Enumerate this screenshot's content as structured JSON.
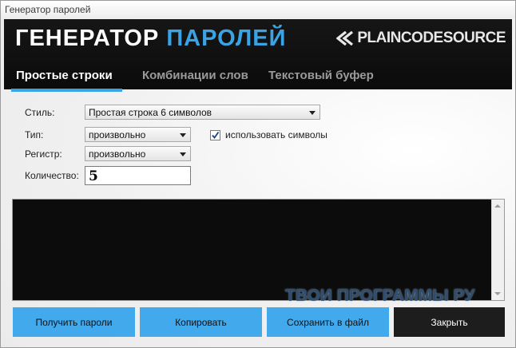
{
  "window": {
    "title": "Генератор паролей"
  },
  "banner": {
    "logo_part1": "ГЕНЕРАТОР",
    "logo_part2": "ПАРОЛЕЙ",
    "brand": "PLAINCODESOURCE"
  },
  "tabs": [
    {
      "label": "Простые строки",
      "active": true
    },
    {
      "label": "Комбинации слов",
      "active": false
    },
    {
      "label": "Текстовый буфер",
      "active": false
    }
  ],
  "form": {
    "style_label": "Стиль:",
    "style_value": "Простая строка 6 символов",
    "type_label": "Тип:",
    "type_value": "произвольно",
    "use_symbols_label": "использовать символы",
    "use_symbols_checked": true,
    "case_label": "Регистр:",
    "case_value": "произвольно",
    "count_label": "Количество:",
    "count_value": "5"
  },
  "watermark": "ТВОИ ПРОГРАММЫ РУ",
  "buttons": {
    "get_passwords": "Получить пароли",
    "copy": "Копировать",
    "save_to_file": "Сохранить в файл",
    "close": "Закрыть"
  },
  "colors": {
    "accent": "#3aa3e5",
    "button": "#41a9ec",
    "banner": "#111111",
    "close_button": "#1d1d1d"
  }
}
